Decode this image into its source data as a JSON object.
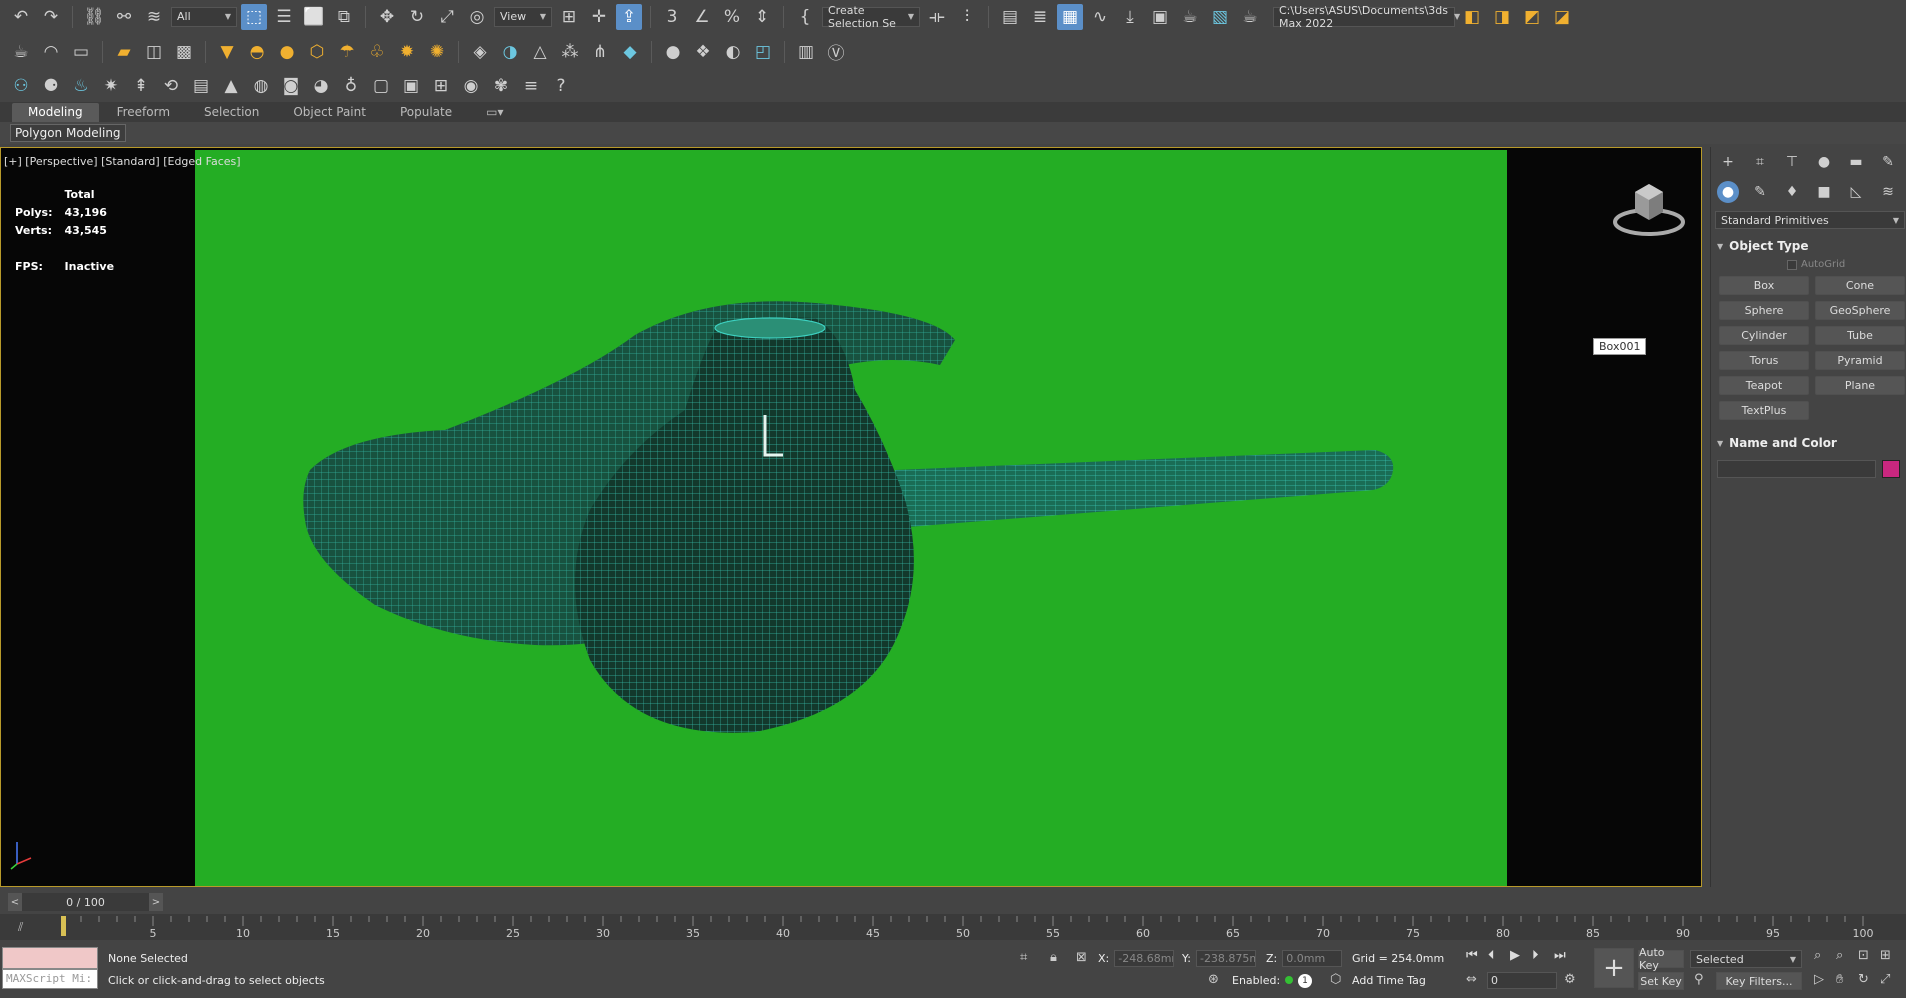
{
  "toolbar": {
    "selection_filter": "All",
    "ref_coord": "View",
    "named_selection": "Create Selection Se",
    "project_path": "C:\\Users\\ASUS\\Documents\\3ds Max 2022"
  },
  "ribbon": {
    "tabs": [
      "Modeling",
      "Freeform",
      "Selection",
      "Object Paint",
      "Populate"
    ],
    "sub_label": "Polygon Modeling"
  },
  "viewport": {
    "label": "[+] [Perspective] [Standard] [Edged Faces]",
    "background_color": "#24ad24",
    "stats": {
      "total": "Total",
      "polys_label": "Polys:",
      "polys": "43,196",
      "verts_label": "Verts:",
      "verts": "43,545",
      "fps_label": "FPS:",
      "fps": "Inactive"
    },
    "tooltip": "Box001"
  },
  "command_panel": {
    "category": "Standard Primitives",
    "object_type_title": "Object Type",
    "autogrid": "AutoGrid",
    "buttons": [
      "Box",
      "Cone",
      "Sphere",
      "GeoSphere",
      "Cylinder",
      "Tube",
      "Torus",
      "Pyramid",
      "Teapot",
      "Plane",
      "TextPlus"
    ],
    "name_color_title": "Name and Color",
    "object_color": "#c9277f"
  },
  "timeline": {
    "slider": "0 / 100",
    "ticks": [
      "5",
      "10",
      "15",
      "20",
      "25",
      "30",
      "35",
      "40",
      "45",
      "50",
      "55",
      "60",
      "65",
      "70",
      "75",
      "80",
      "85",
      "90",
      "95",
      "100"
    ]
  },
  "status": {
    "maxscript": "MAXScript Mi:",
    "selection": "None Selected",
    "prompt": "Click or click-and-drag to select objects",
    "x_label": "X:",
    "x_value": "-248.68mm",
    "y_label": "Y:",
    "y_value": "-238.875mi",
    "z_label": "Z:",
    "z_value": "0.0mm",
    "grid": "Grid = 254.0mm",
    "enabled": "Enabled:",
    "add_time_tag": "Add Time Tag",
    "auto_key": "Auto Key",
    "set_key": "Set Key",
    "selected": "Selected",
    "key_filters": "Key Filters...",
    "frame": "0"
  }
}
